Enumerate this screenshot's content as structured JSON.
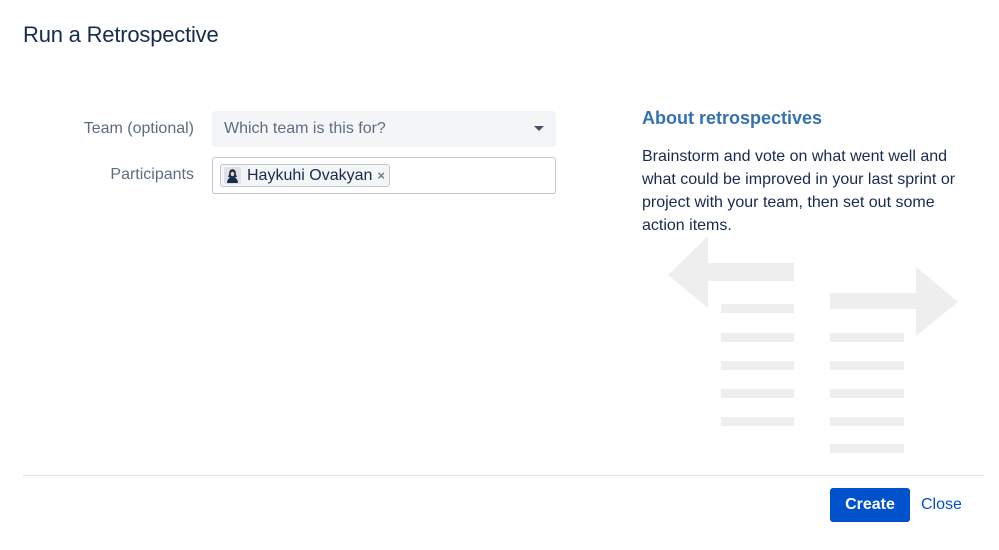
{
  "dialog": {
    "title": "Run a Retrospective"
  },
  "form": {
    "team": {
      "label": "Team (optional)",
      "placeholder": "Which team is this for?"
    },
    "participants": {
      "label": "Participants",
      "chips": [
        {
          "name": "Haykuhi Ovakyan",
          "remove_icon": "×"
        }
      ]
    }
  },
  "about": {
    "title": "About retrospectives",
    "text": "Brainstorm and vote on what went well and what could be improved in your last sprint or project with your team, then set out some action items."
  },
  "footer": {
    "create_label": "Create",
    "close_label": "Close"
  },
  "colors": {
    "primary_button": "#0052cc",
    "link": "#0052cc",
    "heading_accent": "#3572b0",
    "illustration": "#eeeeee"
  },
  "icons": {
    "team_dropdown": "chevron-down-icon",
    "chip_remove": "close-icon",
    "avatar": "user-avatar",
    "illustration": "arrows-and-lists-illustration"
  }
}
